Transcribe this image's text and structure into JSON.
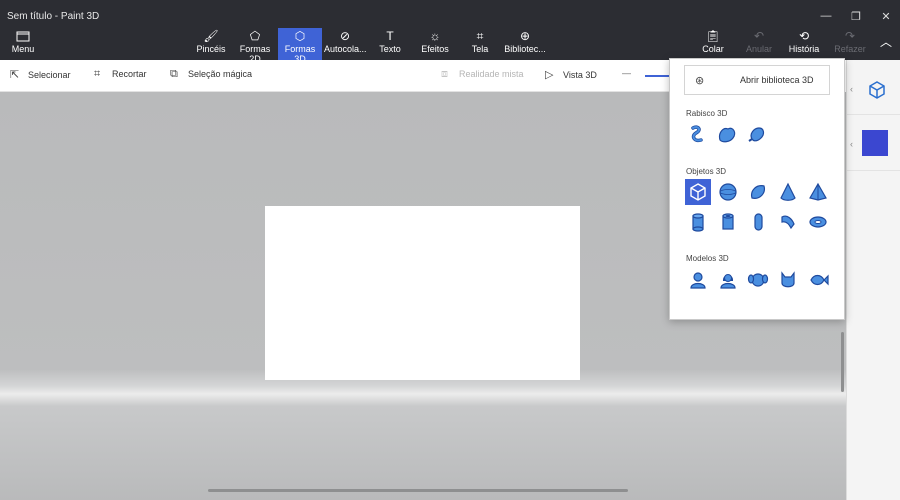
{
  "window": {
    "title": "Sem título - Paint 3D",
    "minimize_glyph": "—",
    "restore_glyph": "❐",
    "close_glyph": "✕"
  },
  "menu": {
    "label": "Menu",
    "icon": "folder-icon"
  },
  "tools": [
    {
      "label": "Pincéis",
      "icon": "brush-icon"
    },
    {
      "label": "Formas 2D",
      "icon": "shapes-2d-icon"
    },
    {
      "label": "Formas 3D",
      "icon": "shapes-3d-icon",
      "active": true
    },
    {
      "label": "Autocola...",
      "icon": "sticker-icon"
    },
    {
      "label": "Texto",
      "icon": "text-icon"
    },
    {
      "label": "Efeitos",
      "icon": "effects-icon"
    },
    {
      "label": "Tela",
      "icon": "canvas-icon"
    },
    {
      "label": "Bibliotec...",
      "icon": "library-icon"
    }
  ],
  "right_tools": [
    {
      "label": "Colar",
      "icon": "paste-icon",
      "disabled": false
    },
    {
      "label": "Anular",
      "icon": "undo-icon",
      "disabled": true
    },
    {
      "label": "História",
      "icon": "history-icon",
      "disabled": false
    },
    {
      "label": "Refazer",
      "icon": "redo-icon",
      "disabled": true
    }
  ],
  "subtoolbar": {
    "select": "Selecionar",
    "crop": "Recortar",
    "magic_select": "Seleção mágica",
    "mixed_reality": "Realidade mista",
    "view_3d": "Vista 3D"
  },
  "flyout": {
    "open_library": "Abrir biblioteca 3D",
    "sections": {
      "doodle": "Rabisco 3D",
      "objects": "Objetos 3D",
      "models": "Modelos 3D"
    }
  },
  "colors": {
    "accent": "#3f63d6",
    "selected_color": "#3b47d0",
    "shape_fill": "#4a8fe0",
    "titlebar": "#2c2d33"
  }
}
